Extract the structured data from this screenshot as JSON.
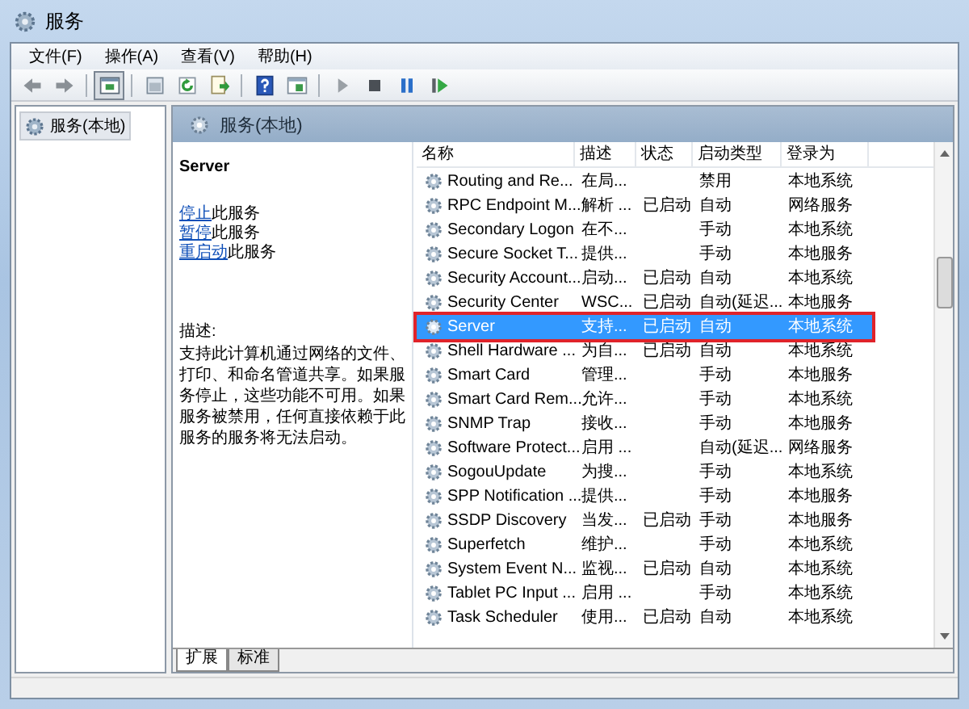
{
  "window": {
    "title": "服务"
  },
  "menu": [
    "文件(F)",
    "操作(A)",
    "查看(V)",
    "帮助(H)"
  ],
  "toolbar": [
    {
      "kind": "back",
      "pressed": false
    },
    {
      "kind": "forward",
      "pressed": false
    },
    {
      "kind": "sep"
    },
    {
      "kind": "tree",
      "pressed": true
    },
    {
      "kind": "sep"
    },
    {
      "kind": "console",
      "pressed": false
    },
    {
      "kind": "refresh",
      "pressed": false
    },
    {
      "kind": "export",
      "pressed": false
    },
    {
      "kind": "sep"
    },
    {
      "kind": "help",
      "pressed": false
    },
    {
      "kind": "properties",
      "pressed": false
    },
    {
      "kind": "sep"
    },
    {
      "kind": "play",
      "pressed": false
    },
    {
      "kind": "stop",
      "pressed": false
    },
    {
      "kind": "pause",
      "pressed": false
    },
    {
      "kind": "restart",
      "pressed": false
    }
  ],
  "tree": {
    "items": [
      {
        "label": "服务(本地)",
        "selected": true
      }
    ]
  },
  "panel": {
    "title": "服务(本地)"
  },
  "details": {
    "service": "Server",
    "actions": [
      {
        "link": "停止",
        "text": "此服务"
      },
      {
        "link": "暂停",
        "text": "此服务"
      },
      {
        "link": "重启动",
        "text": "此服务"
      }
    ],
    "description_label": "描述:",
    "description": "支持此计算机通过网络的文件、打印、和命名管道共享。如果服务停止，这些功能不可用。如果服务被禁用，任何直接依赖于此服务的服务将无法启动。"
  },
  "table": {
    "columns": [
      "名称",
      "描述",
      "状态",
      "启动类型",
      "登录为"
    ],
    "rows": [
      {
        "name": "Routing and Re...",
        "description": "在局...",
        "status": "",
        "startup": "禁用",
        "logon": "本地系统",
        "selected": false
      },
      {
        "name": "RPC Endpoint M...",
        "description": "解析 ...",
        "status": "已启动",
        "startup": "自动",
        "logon": "网络服务",
        "selected": false
      },
      {
        "name": "Secondary Logon",
        "description": "在不...",
        "status": "",
        "startup": "手动",
        "logon": "本地系统",
        "selected": false
      },
      {
        "name": "Secure Socket T...",
        "description": "提供...",
        "status": "",
        "startup": "手动",
        "logon": "本地服务",
        "selected": false
      },
      {
        "name": "Security Account...",
        "description": "启动...",
        "status": "已启动",
        "startup": "自动",
        "logon": "本地系统",
        "selected": false
      },
      {
        "name": "Security Center",
        "description": "WSC...",
        "status": "已启动",
        "startup": "自动(延迟...",
        "logon": "本地服务",
        "selected": false
      },
      {
        "name": "Server",
        "description": "支持...",
        "status": "已启动",
        "startup": "自动",
        "logon": "本地系统",
        "selected": true
      },
      {
        "name": "Shell Hardware ...",
        "description": "为自...",
        "status": "已启动",
        "startup": "自动",
        "logon": "本地系统",
        "selected": false
      },
      {
        "name": "Smart Card",
        "description": "管理...",
        "status": "",
        "startup": "手动",
        "logon": "本地服务",
        "selected": false
      },
      {
        "name": "Smart Card Rem...",
        "description": "允许...",
        "status": "",
        "startup": "手动",
        "logon": "本地系统",
        "selected": false
      },
      {
        "name": "SNMP Trap",
        "description": "接收...",
        "status": "",
        "startup": "手动",
        "logon": "本地服务",
        "selected": false
      },
      {
        "name": "Software Protect...",
        "description": "启用 ...",
        "status": "",
        "startup": "自动(延迟...",
        "logon": "网络服务",
        "selected": false
      },
      {
        "name": "SogouUpdate",
        "description": "为搜...",
        "status": "",
        "startup": "手动",
        "logon": "本地系统",
        "selected": false
      },
      {
        "name": "SPP Notification ...",
        "description": "提供...",
        "status": "",
        "startup": "手动",
        "logon": "本地服务",
        "selected": false
      },
      {
        "name": "SSDP Discovery",
        "description": "当发...",
        "status": "已启动",
        "startup": "手动",
        "logon": "本地服务",
        "selected": false
      },
      {
        "name": "Superfetch",
        "description": "维护...",
        "status": "",
        "startup": "手动",
        "logon": "本地系统",
        "selected": false
      },
      {
        "name": "System Event N...",
        "description": "监视...",
        "status": "已启动",
        "startup": "自动",
        "logon": "本地系统",
        "selected": false
      },
      {
        "name": "Tablet PC Input ...",
        "description": "启用 ...",
        "status": "",
        "startup": "手动",
        "logon": "本地系统",
        "selected": false
      },
      {
        "name": "Task Scheduler",
        "description": "使用...",
        "status": "已启动",
        "startup": "自动",
        "logon": "本地系统",
        "selected": false
      }
    ]
  },
  "tabs": [
    {
      "label": "扩展",
      "selected": true
    },
    {
      "label": "标准",
      "selected": false
    }
  ]
}
